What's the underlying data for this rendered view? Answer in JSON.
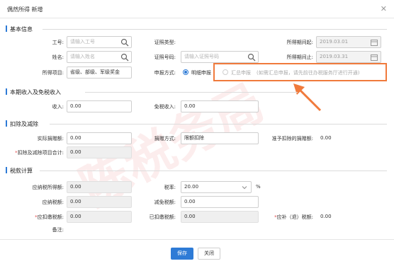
{
  "window": {
    "title": "偶然所得 新增",
    "close_icon": "close-icon"
  },
  "sections": {
    "basic": "基本信息",
    "income": "本期收入及免税收入",
    "deduct": "扣除及减除",
    "tax": "税款计算"
  },
  "basic": {
    "worker_id_label": "工号:",
    "worker_id_placeholder": "请输入工号",
    "id_type_label": "证照类型:",
    "period_start_label": "所得期间起:",
    "period_start_value": "2019.03.01",
    "name_label": "姓名:",
    "name_placeholder": "请输入姓名",
    "id_no_label": "证照号码:",
    "id_no_placeholder": "请输入证照号码",
    "period_end_label": "所得期间止:",
    "period_end_value": "2019.03.31",
    "item_label": "所得项目:",
    "item_value": "省级、部级、军级奖金",
    "declare_label": "申报方式:",
    "declare_option_detail": "明细申报",
    "declare_option_summary": "汇总申报",
    "declare_summary_note": "(如需汇总申报，请先前往办税服务厅进行开通)"
  },
  "income": {
    "income_label": "收入:",
    "income_value": "0.00",
    "free_label": "免税收入:",
    "free_value": "0.00"
  },
  "deduct": {
    "donation_label": "实际捐赠额:",
    "donation_value": "0.00",
    "method_label": "捐赠方式:",
    "method_value": "限额扣除",
    "allowed_label": "准予扣除的捐赠额:",
    "allowed_value": "0.00",
    "total_label": "扣除及减除项目合计:",
    "total_value": "0.00"
  },
  "tax": {
    "taxable_label": "应纳税所得额:",
    "taxable_value": "0.00",
    "rate_label": "税率:",
    "rate_value": "20.00",
    "rate_unit": "%",
    "payable_label": "应纳税额:",
    "payable_value": "0.00",
    "relief_label": "减免税额:",
    "relief_value": "0.00",
    "withhold_label": "应扣缴税额:",
    "withhold_value": "0.00",
    "withheld_label": "已扣缴税额:",
    "withheld_value": "0.00",
    "refund_label": "应补（退）税额:",
    "refund_value": "0.00",
    "remark_label": "备注:"
  },
  "buttons": {
    "save": "保存",
    "close": "关闭"
  },
  "watermark": "陈税务局",
  "colors": {
    "accent": "#2e7bd6",
    "highlight": "#f07a3c",
    "required": "#e34d4d"
  }
}
